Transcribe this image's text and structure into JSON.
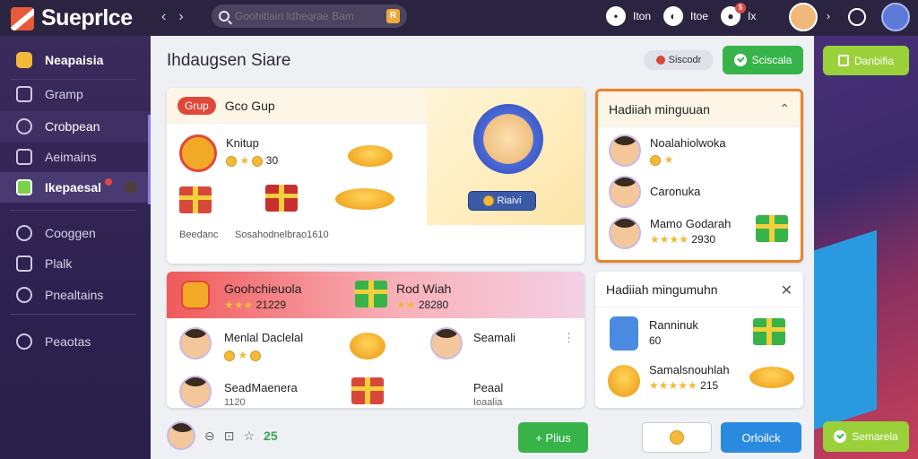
{
  "app": {
    "name": "Sueprlce"
  },
  "topbar": {
    "search_placeholder": "Goohitlairi Idheqrae Bam",
    "actions": [
      {
        "icon": "chat-icon",
        "label": "Iton"
      },
      {
        "icon": "message-icon",
        "label": "Itoe"
      },
      {
        "icon": "people-icon",
        "label": "Ix",
        "badge": "5"
      }
    ]
  },
  "sidebar": {
    "items": [
      {
        "label": "Neapaisia",
        "icon": "app-icon",
        "active": false
      },
      {
        "label": "Gramp",
        "icon": "group-icon"
      },
      {
        "label": "Crobpean",
        "icon": "campaign-icon"
      },
      {
        "label": "Aeimains",
        "icon": "admin-icon"
      },
      {
        "label": "Ikepaesal",
        "icon": "calendar-icon",
        "active": true
      },
      {
        "label": "Cooggen",
        "icon": "heart-icon"
      },
      {
        "label": "Plalk",
        "icon": "chart-icon"
      },
      {
        "label": "Pnealtains",
        "icon": "settings-icon"
      },
      {
        "label": "Peaotas",
        "icon": "info-icon"
      }
    ]
  },
  "main": {
    "title": "Ihdaugsen Siare",
    "secondary_chip": "Siscodr",
    "secondary_button": "Sciscala"
  },
  "group_card": {
    "pill": "Grup",
    "title": "Gco Gup",
    "reward_name": "Knitup",
    "reward_value": "30",
    "footer_left": "Beedanc",
    "footer_right": "Sosahodnelbrao1610",
    "promo_button": "Riaivi"
  },
  "weekly_card": {
    "title": "Hadiiah minguuan",
    "rows": [
      {
        "name": "Noalahiolwoka",
        "stars": "",
        "value": ""
      },
      {
        "name": "Caronuka",
        "stars": "",
        "value": ""
      },
      {
        "name": "Mamo Godarah",
        "stars": "★★★★",
        "value": "2930"
      }
    ]
  },
  "list_card": {
    "header_title": "Goohchieuola",
    "header_stars": "★★★",
    "header_value": "21229",
    "header_title2": "Rod Wiah",
    "header_stars2": "★★",
    "header_value2": "28280",
    "rows": [
      {
        "name": "Menlal Daclelal",
        "name2": "Seamali"
      },
      {
        "name": "SeadMaenera",
        "value": "1120",
        "name2": "Peaal",
        "sub2": "Ioaalia"
      }
    ]
  },
  "weekly_card2": {
    "title": "Hadiiah mingumuhn",
    "rows": [
      {
        "name": "Ranninuk",
        "value": "60"
      },
      {
        "name": "Samalsnouhlah",
        "stars": "★★★★★",
        "value": "215"
      }
    ]
  },
  "bottom": {
    "count": "25",
    "plus_label": "Plius",
    "blue_label": "Orloilck"
  },
  "right": {
    "top_button": "Danbifia",
    "bottom_button": "Semarela"
  }
}
